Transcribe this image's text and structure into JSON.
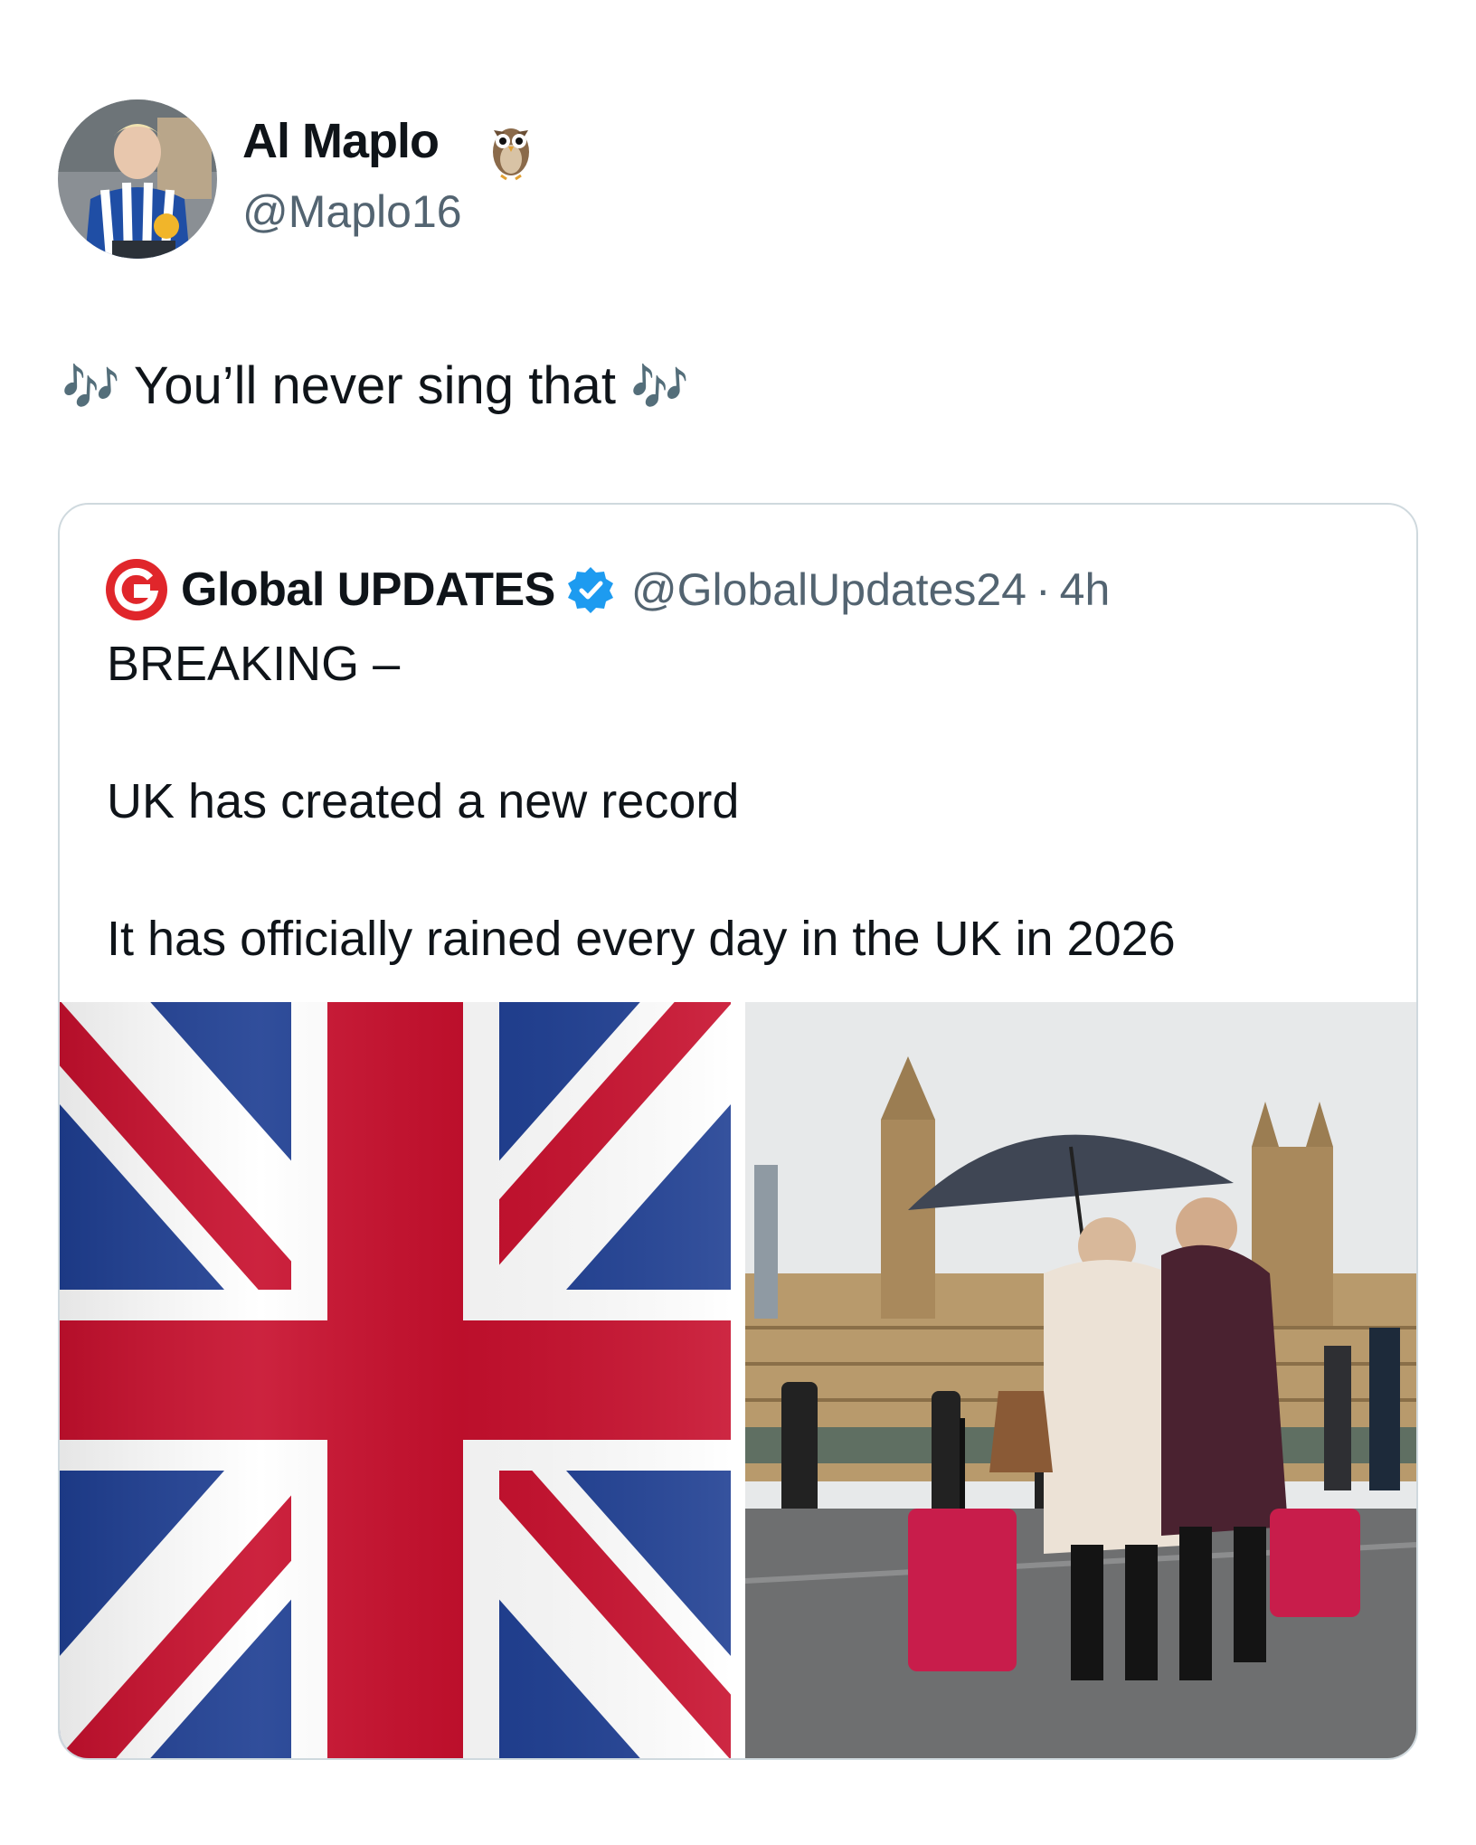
{
  "author": {
    "display_name": "Al Maplo",
    "name_emoji_icon": "owl-icon",
    "handle": "@Maplo16"
  },
  "tweet": {
    "leading_glyph": "🎶",
    "text": "You’ll never sing that",
    "trailing_glyph": "🎶"
  },
  "quoted": {
    "name": "Global UPDATES",
    "logo_icon": "global-updates-logo",
    "verified_icon": "verified-badge-icon",
    "handle": "@GlobalUpdates24",
    "separator": "·",
    "time": "4h",
    "lines": [
      "BREAKING –",
      "UK has created a new record",
      "It has officially rained every day in the UK in 2026"
    ],
    "media": [
      {
        "name": "union-jack-flag-image"
      },
      {
        "name": "rainy-london-photo"
      }
    ]
  },
  "colors": {
    "text": "#0f1419",
    "secondary": "#536471",
    "border": "#cfd9de",
    "verified": "#1d9bf0",
    "logo_red": "#e0262b",
    "flag_blue": "#1f3f93",
    "flag_red": "#c8102e"
  }
}
